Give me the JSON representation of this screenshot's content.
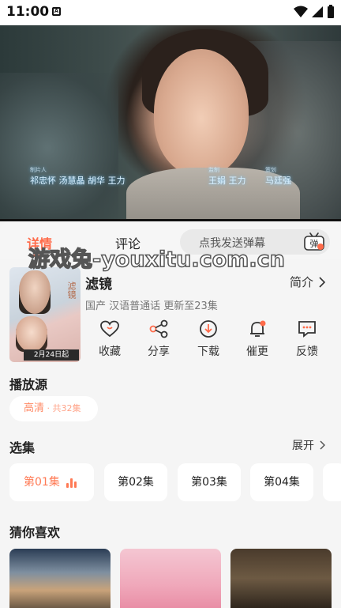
{
  "status_bar": {
    "time": "11:00",
    "notification_glyph": "A",
    "icons": [
      "wifi-icon",
      "signal-icon",
      "battery-icon"
    ]
  },
  "video": {
    "credits_left_role": "制片人",
    "credits_left_names": "祁忠怀  汤慧晶  胡华  王力",
    "credits_right_role": "监制",
    "credits_right_names": "王娟  王力",
    "credits_right2_role": "策划",
    "credits_right2_names": "马廷强"
  },
  "tabs": [
    {
      "label": "详情",
      "active": true
    },
    {
      "label": "评论",
      "active": false
    }
  ],
  "danmu": {
    "placeholder": "点我发送弹幕",
    "button_glyph": "弹"
  },
  "watermark": "游戏兔-youxitu.com.cn",
  "show": {
    "poster_date": "2月24日起",
    "poster_title": "滤镜",
    "title": "滤镜",
    "intro_label": "简介",
    "meta": "国产 汉语普通话 更新至23集"
  },
  "actions": [
    {
      "label": "收藏",
      "icon": "heart-icon"
    },
    {
      "label": "分享",
      "icon": "share-icon"
    },
    {
      "label": "下载",
      "icon": "download-icon"
    },
    {
      "label": "催更",
      "icon": "bell-icon"
    },
    {
      "label": "反馈",
      "icon": "feedback-icon"
    }
  ],
  "play_source": {
    "title": "播放源",
    "chip_quality": "高清",
    "chip_count": " · 共32集"
  },
  "episodes": {
    "title": "选集",
    "expand_label": "展开",
    "items": [
      "第01集",
      "第02集",
      "第03集",
      "第04集"
    ]
  },
  "recommend": {
    "title": "猜你喜欢"
  },
  "colors": {
    "accent": "#ff6b4a",
    "background": "#f5f5f5",
    "card": "#ffffff"
  }
}
